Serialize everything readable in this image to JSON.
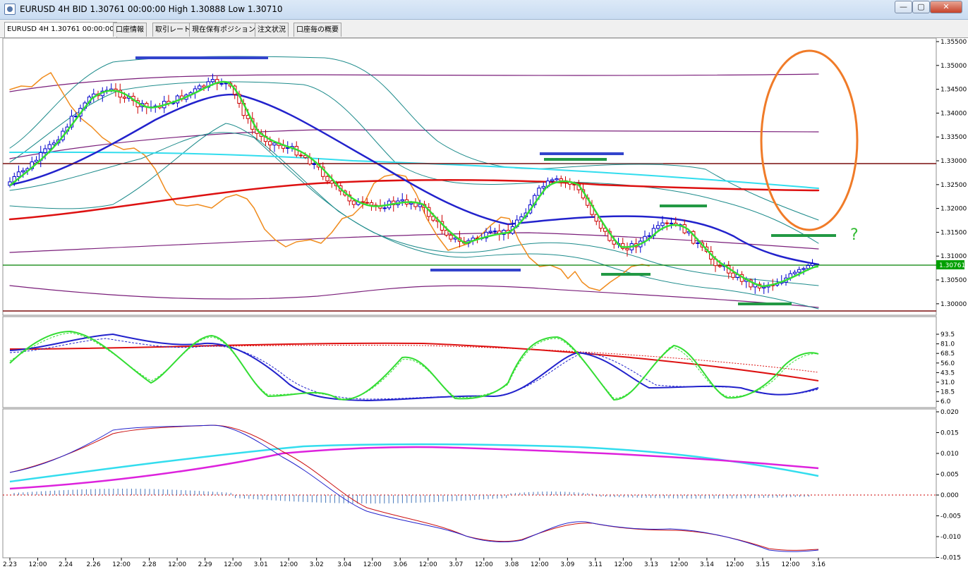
{
  "window": {
    "title": "EURUSD 4H BID 1.30761 00:00:00 High 1.30888 Low 1.30710",
    "minimize": "—",
    "maximize": "▢",
    "close": "✕"
  },
  "tabs": [
    {
      "label": "EURUSD 4H 1.30761 00:00:00",
      "active": true
    },
    {
      "label": "口座情報",
      "active": false
    },
    {
      "label": "取引レート",
      "active": false
    },
    {
      "label": "現在保有ポジション",
      "active": false
    },
    {
      "label": "注文状況",
      "active": false
    },
    {
      "label": "口座毎の概要",
      "active": false
    }
  ],
  "chart_data": [
    {
      "type": "candlestick",
      "symbol": "EURUSD",
      "timeframe": "4H",
      "current_price": "1.30761",
      "current_price_label": "1.30761",
      "x_ticks": [
        "2.23",
        "12:00",
        "2.24",
        "2.26",
        "12:00",
        "2.28",
        "12:00",
        "2.29",
        "12:00",
        "3.01",
        "12:00",
        "3.02",
        "3.04",
        "12:00",
        "3.06",
        "12:00",
        "3.07",
        "12:00",
        "3.08",
        "12:00",
        "3.09",
        "3.11",
        "12:00",
        "3.13",
        "12:00",
        "3.14",
        "12:00",
        "3.15",
        "12:00",
        "3.16"
      ],
      "y_ticks": [
        "1.35500",
        "1.35000",
        "1.34500",
        "1.34000",
        "1.33500",
        "1.33000",
        "1.32500",
        "1.32000",
        "1.31500",
        "1.31000",
        "1.30500",
        "1.30000"
      ],
      "ylim": [
        1.2975,
        1.3565
      ],
      "annotation": "?",
      "colors": {
        "bull": "#0000cc",
        "bear": "#cc0000",
        "ma_fast": "#33dd33",
        "ma_mid": "#2222cc",
        "ma_long": "#dd1111",
        "ma_cyan": "#33ddee",
        "chikou": "#f08c1e",
        "band_outer": "#1b8a8a",
        "band_purple": "#7a1e7a"
      }
    },
    {
      "type": "line",
      "y_ticks": [
        "93.5",
        "81.0",
        "68.5",
        "56.0",
        "43.5",
        "31.0",
        "18.5",
        "6.0"
      ],
      "ylim": [
        0,
        100
      ]
    },
    {
      "type": "line",
      "y_ticks": [
        "0.020",
        "0.015",
        "0.010",
        "0.005",
        "0.000",
        "-0.005",
        "-0.010",
        "-0.015"
      ],
      "ylim": [
        -0.015,
        0.02
      ]
    }
  ]
}
